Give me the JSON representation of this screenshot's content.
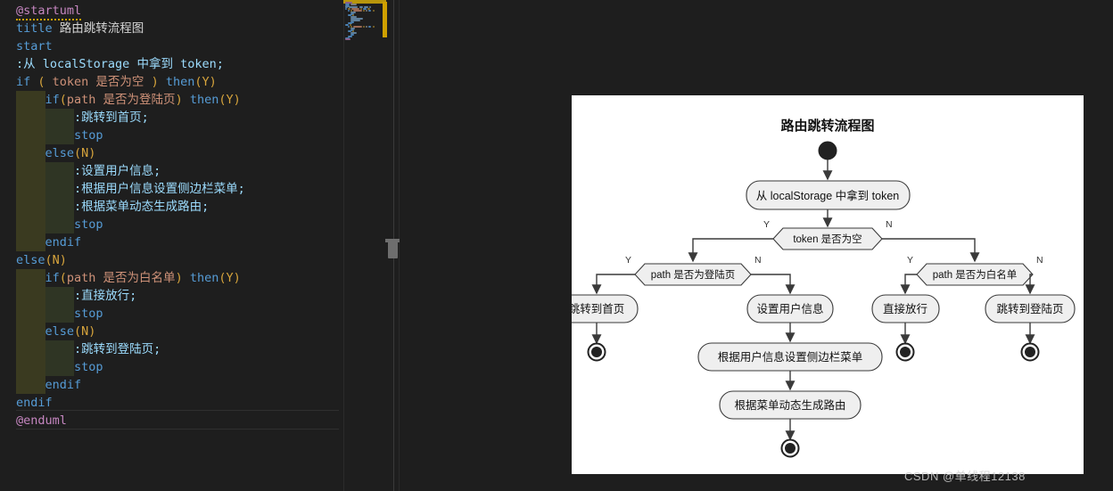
{
  "editor": {
    "language": "plantuml",
    "lines": [
      {
        "indent": 0,
        "parts": [
          {
            "t": "@startuml",
            "c": "meta",
            "squiggle": true
          }
        ]
      },
      {
        "indent": 0,
        "parts": [
          {
            "t": "title",
            "c": "kw"
          },
          {
            "t": " 路由跳转流程图",
            "c": "plain"
          }
        ]
      },
      {
        "indent": 0,
        "parts": [
          {
            "t": "start",
            "c": "kw"
          }
        ]
      },
      {
        "indent": 0,
        "parts": [
          {
            "t": ":从 ",
            "c": "str"
          },
          {
            "t": "localStorage",
            "c": "id"
          },
          {
            "t": " 中拿到 ",
            "c": "str"
          },
          {
            "t": "token",
            "c": "id"
          },
          {
            "t": ";",
            "c": "str"
          }
        ]
      },
      {
        "indent": 0,
        "parts": [
          {
            "t": "if",
            "c": "kw"
          },
          {
            "t": " ( ",
            "c": "paren"
          },
          {
            "t": "token 是否为空",
            "c": "cond"
          },
          {
            "t": " ) ",
            "c": "paren"
          },
          {
            "t": "then",
            "c": "kw"
          },
          {
            "t": "(Y)",
            "c": "paren"
          }
        ]
      },
      {
        "indent": 1,
        "parts": [
          {
            "t": "if",
            "c": "kw"
          },
          {
            "t": "(",
            "c": "paren"
          },
          {
            "t": "path 是否为登陆页",
            "c": "cond"
          },
          {
            "t": ")",
            "c": "paren"
          },
          {
            "t": " ",
            "c": "plain"
          },
          {
            "t": "then",
            "c": "kw"
          },
          {
            "t": "(Y)",
            "c": "paren"
          }
        ]
      },
      {
        "indent": 2,
        "parts": [
          {
            "t": ":跳转到首页;",
            "c": "str"
          }
        ]
      },
      {
        "indent": 2,
        "parts": [
          {
            "t": "stop",
            "c": "kw"
          }
        ]
      },
      {
        "indent": 1,
        "parts": [
          {
            "t": "else",
            "c": "kw"
          },
          {
            "t": "(N)",
            "c": "paren"
          }
        ]
      },
      {
        "indent": 2,
        "parts": [
          {
            "t": ":设置用户信息;",
            "c": "str"
          }
        ]
      },
      {
        "indent": 2,
        "parts": [
          {
            "t": ":根据用户信息设置侧边栏菜单;",
            "c": "str"
          }
        ]
      },
      {
        "indent": 2,
        "parts": [
          {
            "t": ":根据菜单动态生成路由;",
            "c": "str"
          }
        ]
      },
      {
        "indent": 2,
        "parts": [
          {
            "t": "stop",
            "c": "kw"
          }
        ]
      },
      {
        "indent": 1,
        "parts": [
          {
            "t": "endif",
            "c": "kw"
          }
        ]
      },
      {
        "indent": 0,
        "parts": [
          {
            "t": "else",
            "c": "kw"
          },
          {
            "t": "(N)",
            "c": "paren"
          }
        ]
      },
      {
        "indent": 1,
        "parts": [
          {
            "t": "if",
            "c": "kw"
          },
          {
            "t": "(",
            "c": "paren"
          },
          {
            "t": "path 是否为白名单",
            "c": "cond"
          },
          {
            "t": ")",
            "c": "paren"
          },
          {
            "t": " ",
            "c": "plain"
          },
          {
            "t": "then",
            "c": "kw"
          },
          {
            "t": "(Y)",
            "c": "paren"
          }
        ]
      },
      {
        "indent": 2,
        "parts": [
          {
            "t": ":直接放行;",
            "c": "str"
          }
        ]
      },
      {
        "indent": 2,
        "parts": [
          {
            "t": "stop",
            "c": "kw"
          }
        ]
      },
      {
        "indent": 1,
        "parts": [
          {
            "t": "else",
            "c": "kw"
          },
          {
            "t": "(N)",
            "c": "paren"
          }
        ]
      },
      {
        "indent": 2,
        "parts": [
          {
            "t": ":跳转到登陆页;",
            "c": "str"
          }
        ]
      },
      {
        "indent": 2,
        "parts": [
          {
            "t": "stop",
            "c": "kw"
          }
        ]
      },
      {
        "indent": 1,
        "parts": [
          {
            "t": "endif",
            "c": "kw"
          }
        ]
      },
      {
        "indent": 0,
        "parts": [
          {
            "t": "endif",
            "c": "kw"
          }
        ]
      },
      {
        "indent": 0,
        "parts": [
          {
            "t": "@enduml",
            "c": "meta"
          }
        ]
      }
    ],
    "colors": {
      "background": "#1e1e1e",
      "keyword": "#569cd6",
      "meta": "#c586c0",
      "paren": "#d7a43c",
      "condition": "#ce9178",
      "string": "#9cdcfe",
      "plain": "#d4d4d4",
      "indent_guide": "#3a3a20",
      "squiggle": "#cfa000"
    }
  },
  "minimap": {
    "name": "code-minimap",
    "highlight_color": "#b8960c",
    "marker_color": "#cfa000"
  },
  "scrollbar": {
    "thumb_color": "#6e6e6e"
  },
  "diagram": {
    "title": "路由跳转流程图",
    "background": "#ffffff",
    "node_fill": "#efefef",
    "node_stroke": "#3a3a3a",
    "nodes": {
      "start": "start-node",
      "a1": "从 localStorage 中拿到 token",
      "d1": "token 是否为空",
      "d1_yes": "Y",
      "d1_no": "N",
      "d2": "path 是否为登陆页",
      "d2_yes": "Y",
      "d2_no": "N",
      "a2": "跳转到首页",
      "a3": "设置用户信息",
      "a4": "根据用户信息设置侧边栏菜单",
      "a5": "根据菜单动态生成路由",
      "d3": "path 是否为白名单",
      "d3_yes": "Y",
      "d3_no": "N",
      "a6": "直接放行",
      "a7": "跳转到登陆页"
    }
  },
  "watermark": {
    "text": "CSDN @单线程12138"
  }
}
